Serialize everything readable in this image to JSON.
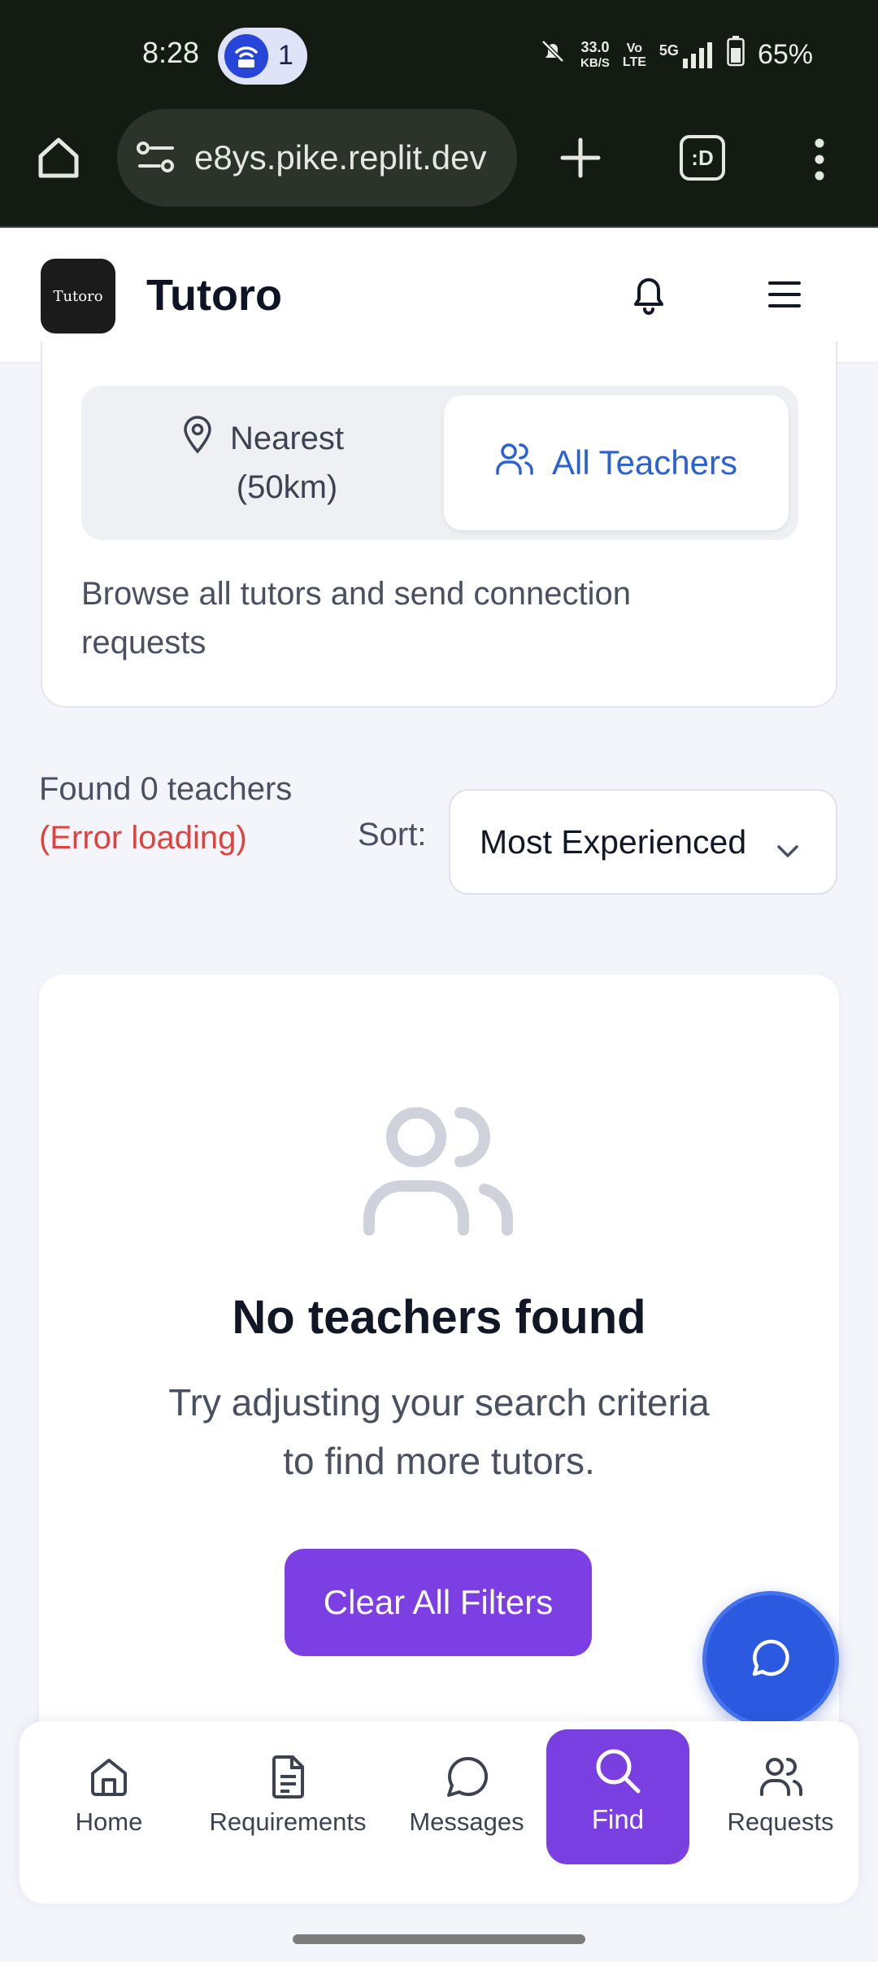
{
  "status_bar": {
    "time": "8:28",
    "hotspot_count": "1",
    "speed_value": "33.0",
    "speed_unit": "KB/S",
    "volte": "Vo\nLTE",
    "network": "5G",
    "battery": "65%"
  },
  "browser": {
    "url": "e8ys.pike.replit.dev",
    "tab_switcher_label": ":D"
  },
  "header": {
    "app_name": "Tutoro",
    "logo_text": "Tutoro"
  },
  "filter": {
    "tab_nearest": "Nearest\n(50km)",
    "tab_all": "All Teachers",
    "description": "Browse all tutors and send connection requests"
  },
  "results": {
    "found_text": "Found 0 teachers",
    "error_text": "(Error loading)",
    "sort_label": "Sort:",
    "sort_value": "Most Experienced"
  },
  "empty_state": {
    "title": "No teachers found",
    "subtitle": "Try adjusting your search criteria to find more tutors.",
    "button": "Clear All Filters"
  },
  "nav": {
    "home": "Home",
    "requirements": "Requirements",
    "messages": "Messages",
    "find": "Find",
    "requests": "Requests"
  },
  "colors": {
    "accent_purple": "#7b3fe4",
    "accent_blue": "#2a61d4",
    "error_red": "#e0423e"
  }
}
